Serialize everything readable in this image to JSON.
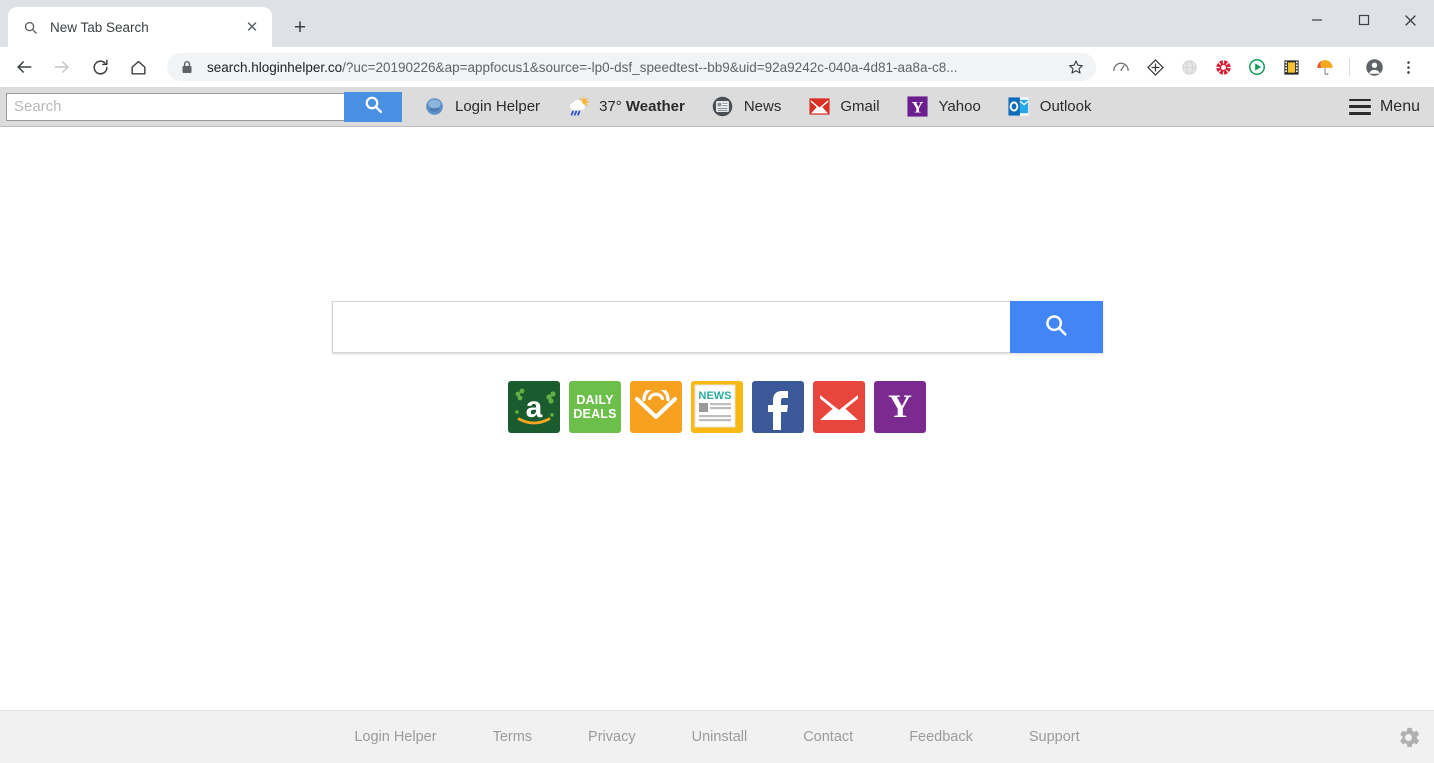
{
  "browser": {
    "tab": {
      "title": "New Tab Search",
      "favicon": "search-icon",
      "close_label": "✕"
    },
    "new_tab_label": "+",
    "window_controls": {
      "minimize": "—",
      "maximize": "□",
      "close": "✕"
    },
    "nav": {
      "back": "back-arrow-icon",
      "forward": "forward-arrow-icon",
      "reload": "reload-icon",
      "home": "home-icon"
    },
    "omnibox": {
      "lock": "lock-icon",
      "host": "search.hloginhelper.co",
      "path": "/?uc=20190226&ap=appfocus1&source=-lp0-dsf_speedtest--bb9&uid=92a9242c-040a-4d81-aa8a-c8...",
      "bookmark": "star-icon"
    },
    "extensions": [
      {
        "name": "speedometer-icon"
      },
      {
        "name": "diamond-arrows-icon"
      },
      {
        "name": "globe-icon"
      },
      {
        "name": "red-circle-icon"
      },
      {
        "name": "green-play-icon"
      },
      {
        "name": "film-strip-icon"
      },
      {
        "name": "umbrella-icon"
      }
    ],
    "profile": "account-avatar-icon",
    "menu": "three-dot-menu-icon"
  },
  "toolbar": {
    "search_placeholder": "Search",
    "search_value": "",
    "search_button_icon": "search-icon",
    "items": [
      {
        "label": "Login Helper",
        "icon": "login-helper-orb-icon"
      },
      {
        "label": "37° Weather",
        "temp": "37°",
        "name": "Weather",
        "icon": "weather-rain-sun-icon"
      },
      {
        "label": "News",
        "icon": "news-circle-icon"
      },
      {
        "label": "Gmail",
        "icon": "gmail-envelope-icon"
      },
      {
        "label": "Yahoo",
        "icon": "yahoo-y-icon"
      },
      {
        "label": "Outlook",
        "icon": "outlook-o-icon"
      }
    ],
    "menu_label": "Menu",
    "menu_icon": "hamburger-icon"
  },
  "page": {
    "search": {
      "value": "",
      "placeholder": "",
      "button_icon": "search-icon"
    },
    "tiles": [
      {
        "name": "amazon",
        "label": "a",
        "bg": "#1b5c2e"
      },
      {
        "name": "daily-deals",
        "line1": "DAILY",
        "line2": "DEALS",
        "bg": "#6cbf4b"
      },
      {
        "name": "audible",
        "bg": "#f5a01f"
      },
      {
        "name": "news",
        "label": "NEWS",
        "bg": "#fcb813"
      },
      {
        "name": "facebook",
        "label": "f",
        "bg": "#3b5998"
      },
      {
        "name": "gmail",
        "bg": "#e8453c"
      },
      {
        "name": "yahoo",
        "label": "Y",
        "bg": "#7b2a90"
      }
    ]
  },
  "footer": {
    "links": [
      "Login Helper",
      "Terms",
      "Privacy",
      "Uninstall",
      "Contact",
      "Feedback",
      "Support"
    ],
    "settings_icon": "gear-icon"
  },
  "colors": {
    "accent_blue": "#4285f4",
    "toolbar_blue": "#4a90e2",
    "titlebar": "#dee1e6",
    "ext_toolbar": "#dcdcdc",
    "footer": "#f1f1f1"
  }
}
